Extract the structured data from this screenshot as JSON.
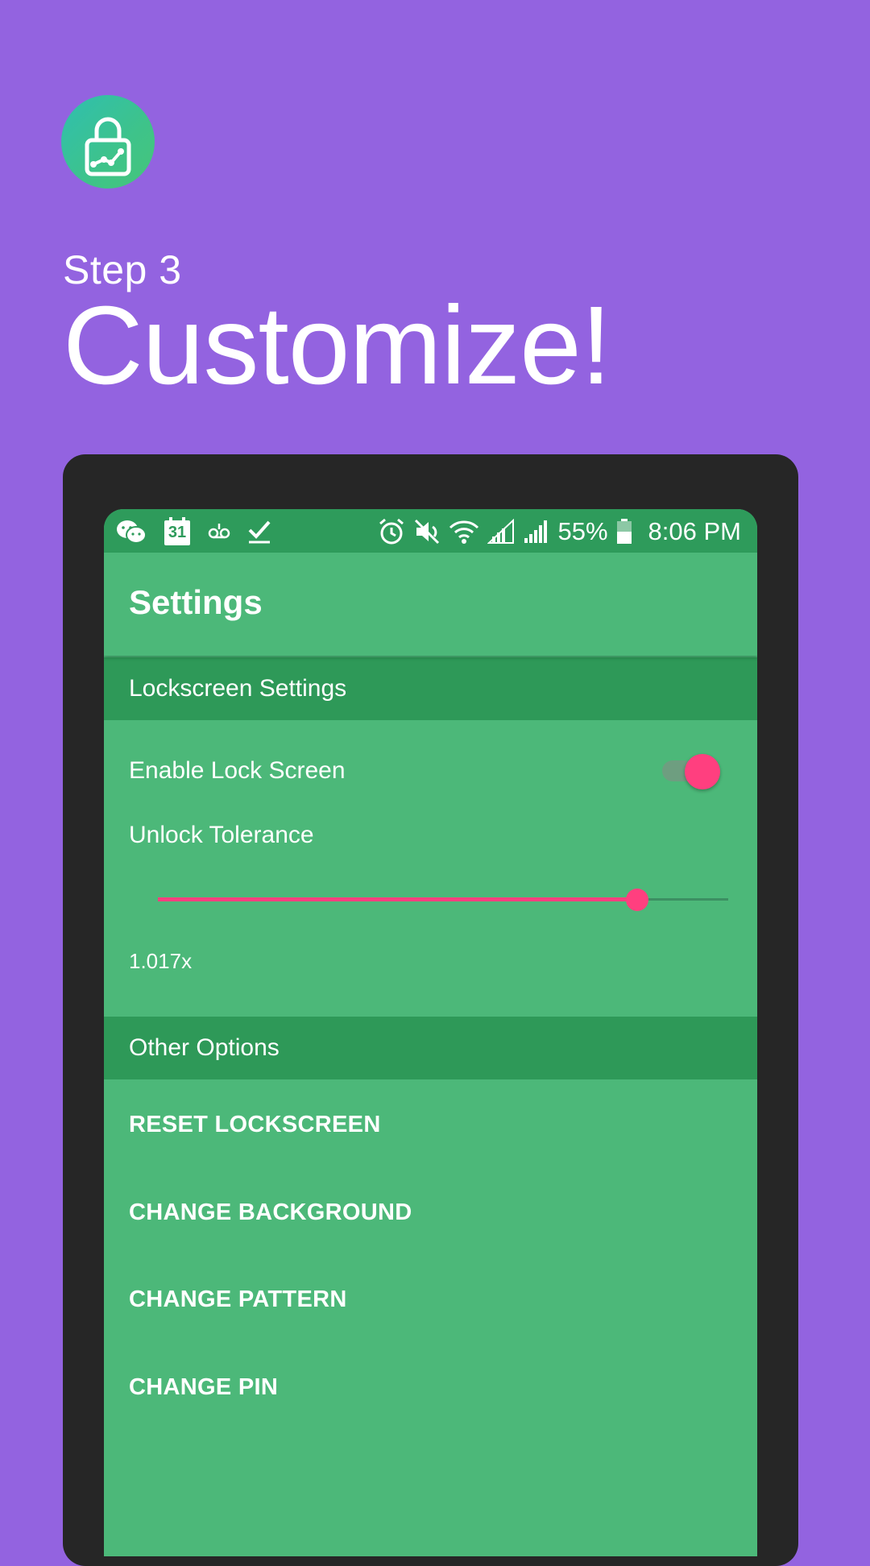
{
  "colors": {
    "background": "#9363E0",
    "accent": "#FF3F7F",
    "primary": "#4CB879",
    "primary_dark": "#2E9B5B",
    "device_frame": "#262626"
  },
  "logo": {
    "icon": "lock-pattern-icon"
  },
  "promo": {
    "step": "Step 3",
    "headline": "Customize!"
  },
  "statusbar": {
    "left_icons": [
      "wechat-icon",
      "calendar-icon",
      "voicemail-icon",
      "checkmark-icon"
    ],
    "calendar_day": "31",
    "right_icons": [
      "alarm-icon",
      "mute-icon",
      "wifi-icon",
      "signal-icon",
      "signal-icon",
      "battery-icon"
    ],
    "battery": "55%",
    "time": "8:06 PM"
  },
  "appbar": {
    "title": "Settings"
  },
  "lockscreen_section": {
    "header": "Lockscreen Settings",
    "enable_lock_screen": {
      "label": "Enable Lock Screen",
      "checked": true
    },
    "unlock_tolerance": {
      "label": "Unlock Tolerance",
      "value_text": "1.017x",
      "slider_fraction": 0.84
    }
  },
  "other_section": {
    "header": "Other Options",
    "actions": [
      "RESET LOCKSCREEN",
      "CHANGE BACKGROUND",
      "CHANGE PATTERN",
      "CHANGE PIN"
    ]
  }
}
